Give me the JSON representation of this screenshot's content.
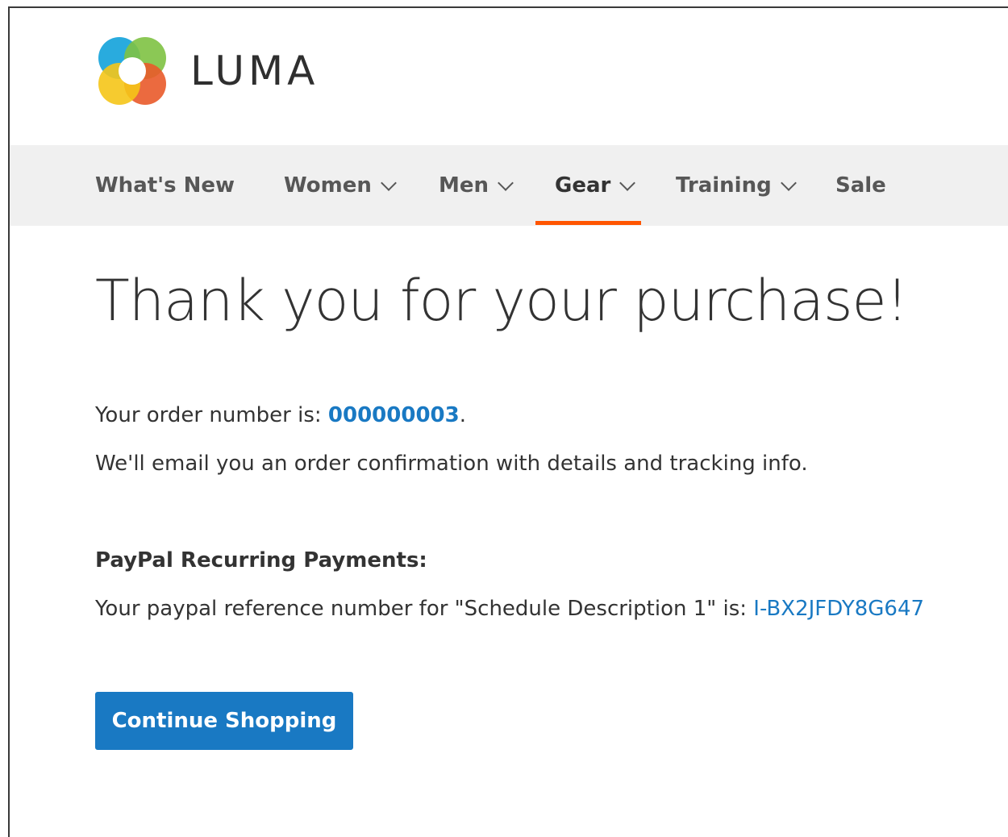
{
  "brand": {
    "name": "LUMA",
    "logo_colors": [
      "#1ea6dc",
      "#7ec242",
      "#f58220",
      "#f5c518",
      "#e95a2a"
    ]
  },
  "nav": {
    "items": [
      {
        "label": "What's New",
        "has_dropdown": false
      },
      {
        "label": "Women",
        "has_dropdown": true
      },
      {
        "label": "Men",
        "has_dropdown": true
      },
      {
        "label": "Gear",
        "has_dropdown": true,
        "active": true
      },
      {
        "label": "Training",
        "has_dropdown": true
      },
      {
        "label": "Sale",
        "has_dropdown": false
      }
    ],
    "active_color": "#ff5501"
  },
  "page": {
    "title": "Thank you for your purchase!",
    "order_prefix": "Your order number is: ",
    "order_number": "000000003",
    "order_suffix": ".",
    "email_notice": "We'll email you an order confirmation with details and tracking info.",
    "paypal_heading": "PayPal Recurring Payments:",
    "paypal_text": "Your paypal reference number for \"Schedule Description 1\" is: ",
    "paypal_reference": "I-BX2JFDY8G647",
    "continue_button": "Continue Shopping"
  },
  "colors": {
    "link": "#1979c3",
    "button_bg": "#1979c3",
    "nav_bg": "#f0f0f0"
  }
}
